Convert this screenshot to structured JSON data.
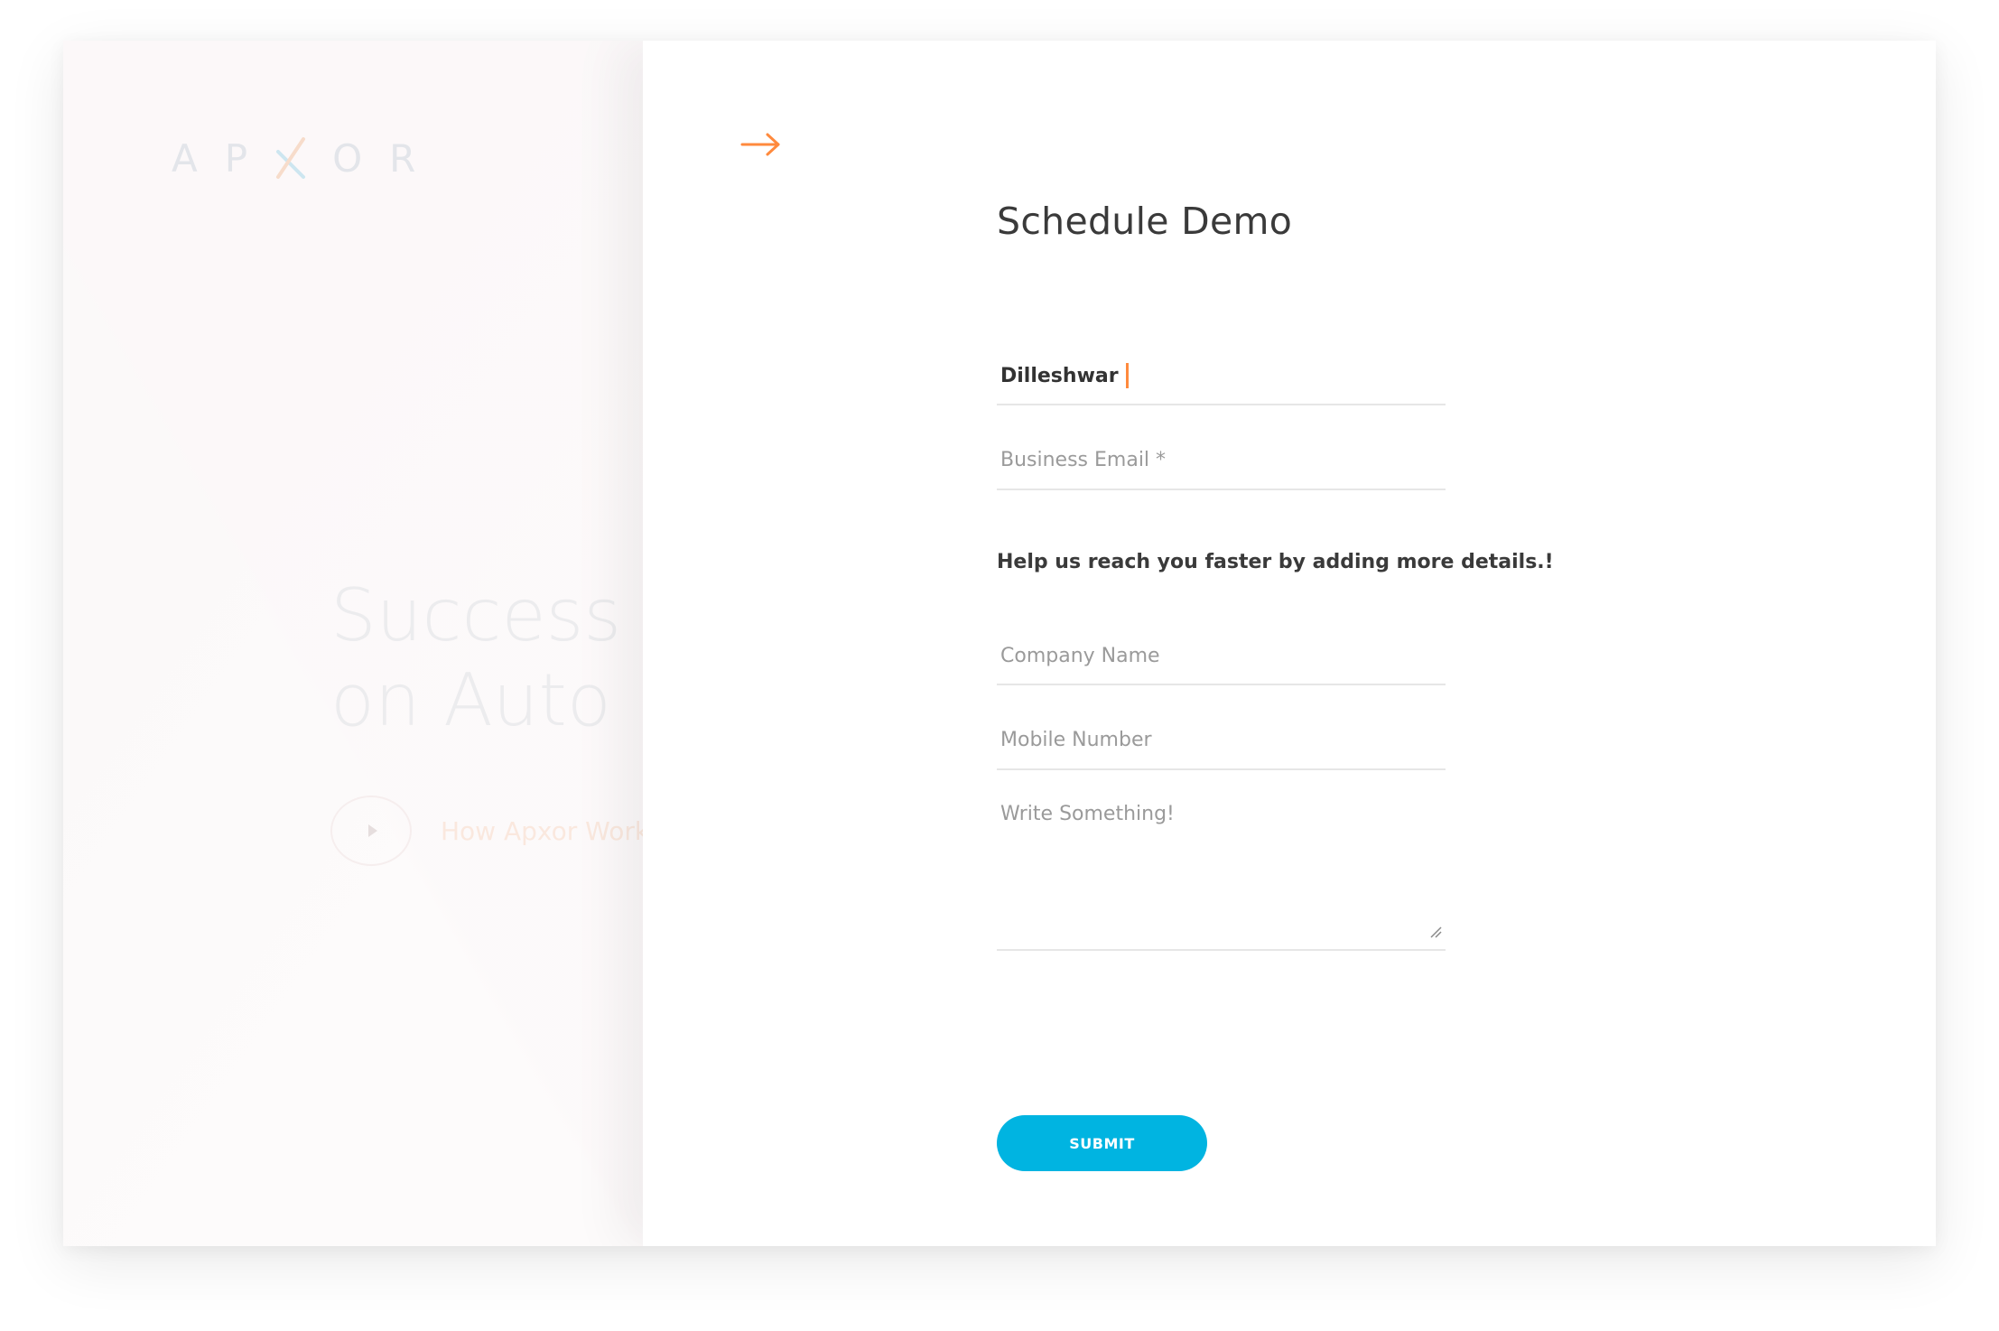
{
  "background_page": {
    "logo_text": "APXOR",
    "hero_line_1": "Success M",
    "hero_line_2": "on Auto P",
    "video_link_label": "How Apxor Work"
  },
  "drawer": {
    "close_icon": "arrow-right-icon",
    "title": "Schedule Demo",
    "name_field": {
      "value": "Dilleshwar"
    },
    "email_field": {
      "placeholder": "Business Email *"
    },
    "helper_text": "Help us reach you faster by adding more details.!",
    "company_field": {
      "placeholder": "Company Name"
    },
    "mobile_field": {
      "placeholder": "Mobile Number"
    },
    "message_field": {
      "placeholder": "Write Something!"
    },
    "submit_label": "SUBMIT"
  },
  "colors": {
    "accent_orange": "#ff8a3d",
    "submit_blue": "#00b4e1",
    "title_text": "#3a3a3a",
    "placeholder_text": "#9a9a9a",
    "field_underline": "#e6e6e6"
  }
}
